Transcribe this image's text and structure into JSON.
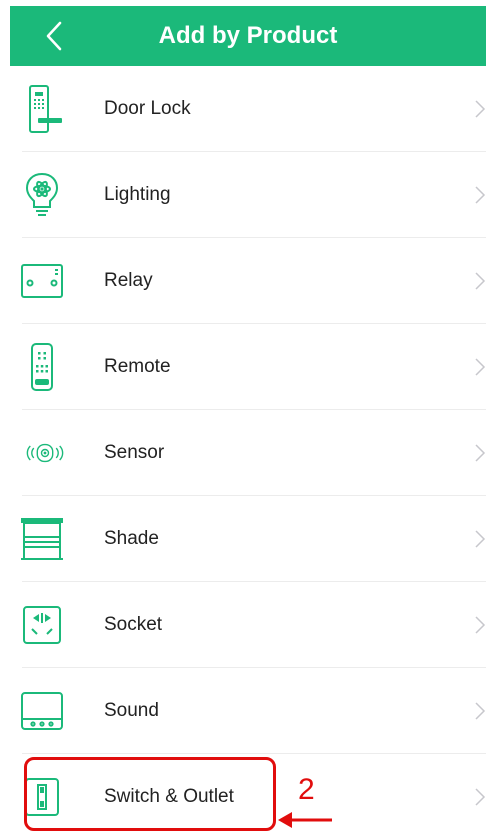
{
  "header": {
    "title": "Add by Product",
    "back_icon": "chevron-left-icon"
  },
  "items": [
    {
      "label": "Door Lock",
      "icon": "door-lock-icon"
    },
    {
      "label": "Lighting",
      "icon": "lighting-icon"
    },
    {
      "label": "Relay",
      "icon": "relay-icon"
    },
    {
      "label": "Remote",
      "icon": "remote-icon"
    },
    {
      "label": "Sensor",
      "icon": "sensor-icon"
    },
    {
      "label": "Shade",
      "icon": "shade-icon"
    },
    {
      "label": "Socket",
      "icon": "socket-icon"
    },
    {
      "label": "Sound",
      "icon": "sound-icon"
    },
    {
      "label": "Switch & Outlet",
      "icon": "switch-outlet-icon"
    }
  ],
  "annotation": {
    "number": "2",
    "color": "#e10d0d"
  },
  "colors": {
    "brand": "#1bb97a",
    "icon": "#1bb97a",
    "text": "#222222",
    "chevron": "#c7c7cc"
  }
}
